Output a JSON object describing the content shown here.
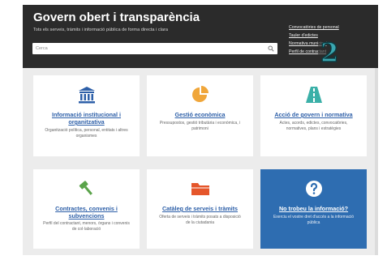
{
  "header": {
    "title": "Govern obert i transparència",
    "subtitle": "Tots els serveis, tràmits i informació pública de forma directa i clara",
    "search_placeholder": "Cerca",
    "links": [
      "Convocatòries de personal",
      "Tauler d'edictes",
      "Normativa municipal",
      "Perfil de contractant"
    ]
  },
  "badge": "2",
  "cards": [
    {
      "title": "Informació institucional i organitzativa",
      "desc": "Organització política, personal, entitats i altres organismes",
      "icon": "institution-icon",
      "color": "#2d5fa8"
    },
    {
      "title": "Gestió econòmica",
      "desc": "Pressupostos, gestió tributària i econòmica, i patrimoni",
      "icon": "pie-chart-icon",
      "color": "#f0a63a"
    },
    {
      "title": "Acció de govern i normativa",
      "desc": "Actes, acords, edictes, convocatòries, normatives, plans i estratègies",
      "icon": "road-icon",
      "color": "#3bb0a8"
    },
    {
      "title": "Contractes, convenis i subvencions",
      "desc": "Perfil del contractant, menors, òrgans i convenis de col·laboració",
      "icon": "gavel-icon",
      "color": "#5aa34a"
    },
    {
      "title": "Catàleg de serveis i tràmits",
      "desc": "Oferta de serveis i tràmits posats a disposició de la ciutadania",
      "icon": "folder-icon",
      "color": "#e5562b"
    },
    {
      "title": "No trobeu la informació?",
      "desc": "Exerciu el vostre dret d'accés a la informació pública",
      "icon": "question-icon",
      "color": "#ffffff"
    }
  ]
}
